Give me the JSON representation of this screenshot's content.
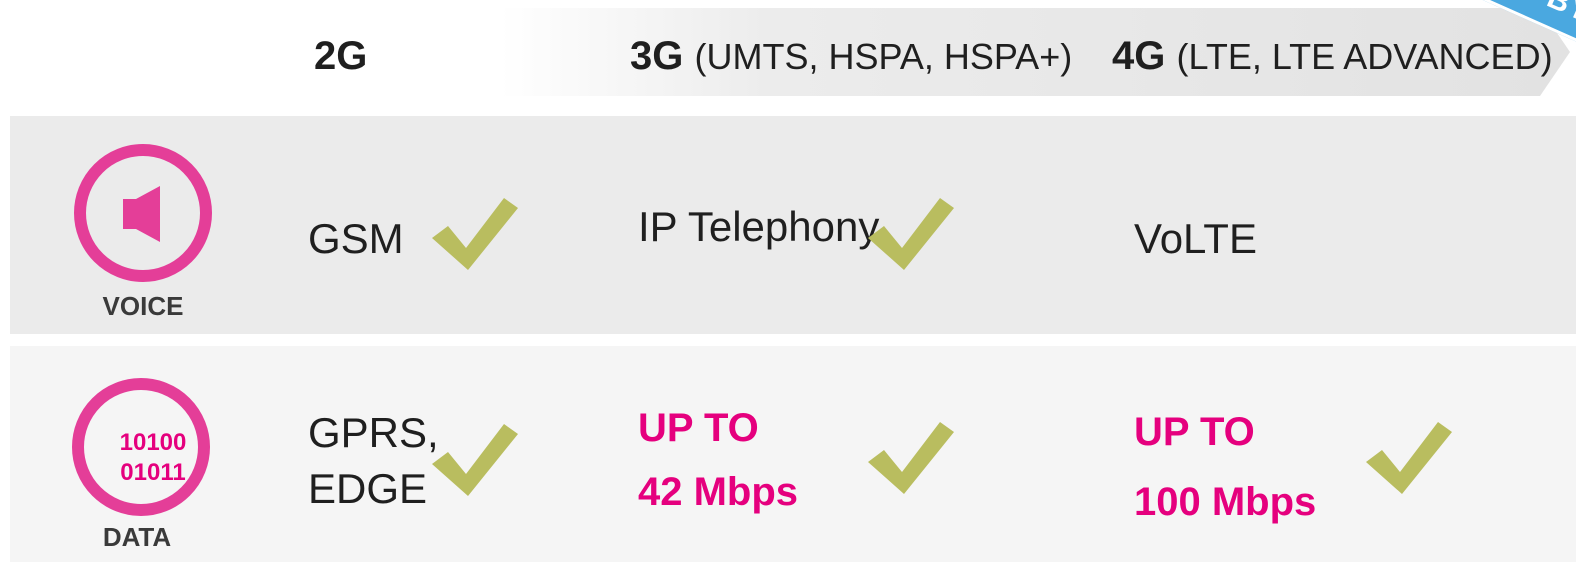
{
  "colors": {
    "magenta": "#e5007e",
    "circle_pink": "#e43e98",
    "check_green": "#b9bd5f",
    "ribbon_blue": "#4aa8e0"
  },
  "ribbon": {
    "text": "ON BY"
  },
  "header": {
    "g2": {
      "label": "2G",
      "sub": ""
    },
    "g3": {
      "label": "3G",
      "sub": "(UMTS, HSPA, HSPA+)"
    },
    "g4": {
      "label": "4G",
      "sub": "(LTE, LTE ADVANCED)"
    }
  },
  "voice": {
    "label": "VOICE",
    "icon": "speaker-icon",
    "g2": "GSM",
    "g3": "IP Telephony",
    "g4": "VoLTE"
  },
  "data": {
    "label": "DATA",
    "icon": "binary-icon",
    "bits_line1": "10100",
    "bits_line2": "01011",
    "g2_line1": "GPRS,",
    "g2_line2": "EDGE",
    "g3_line1": "UP TO",
    "g3_line2": "42 Mbps",
    "g4_line1": "UP TO",
    "g4_line2": "100 Mbps"
  }
}
